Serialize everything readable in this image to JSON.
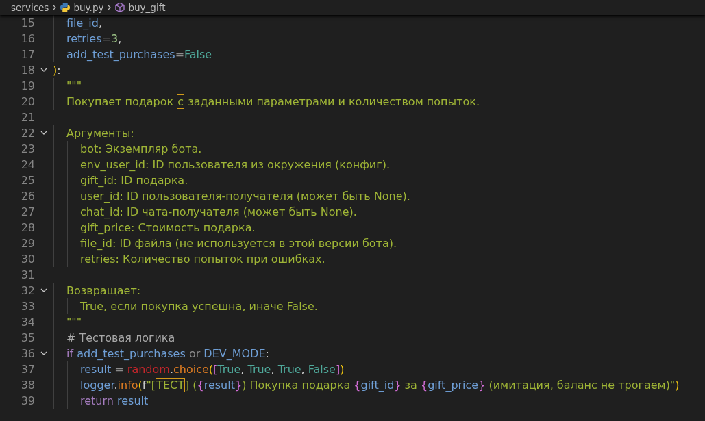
{
  "breadcrumb": [
    {
      "label": "services",
      "kind": "folder"
    },
    {
      "label": "buy.py",
      "kind": "python"
    },
    {
      "label": "buy_gift",
      "kind": "function"
    }
  ],
  "lines": [
    {
      "number": "15",
      "fold": false,
      "tokens": [
        {
          "text": "    file_id",
          "kind": "var"
        },
        {
          "text": ",",
          "kind": "punct"
        }
      ]
    },
    {
      "number": "16",
      "fold": false,
      "tokens": [
        {
          "text": "    retries",
          "kind": "var"
        },
        {
          "text": "=",
          "kind": "op"
        },
        {
          "text": "3",
          "kind": "num"
        },
        {
          "text": ",",
          "kind": "punct"
        }
      ]
    },
    {
      "number": "17",
      "fold": false,
      "tokens": [
        {
          "text": "    add_test_purchases",
          "kind": "var"
        },
        {
          "text": "=",
          "kind": "op"
        },
        {
          "text": "False",
          "kind": "const"
        }
      ]
    },
    {
      "number": "18",
      "fold": true,
      "tokens": [
        {
          "text": ")",
          "kind": "paren"
        },
        {
          "text": ":",
          "kind": "punct"
        }
      ]
    },
    {
      "number": "19",
      "fold": false,
      "tokens": [
        {
          "text": "    \"\"\"",
          "kind": "doc"
        }
      ]
    },
    {
      "number": "20",
      "fold": false,
      "tokens": [
        {
          "text": "    Покупает подарок ",
          "kind": "doc"
        },
        {
          "text": "с",
          "kind": "doc",
          "boxed": true
        },
        {
          "text": " заданными параметрами и количеством попыток.",
          "kind": "doc"
        }
      ]
    },
    {
      "number": "21",
      "fold": false
    },
    {
      "number": "22",
      "fold": true,
      "tokens": [
        {
          "text": "    Аргументы:",
          "kind": "doc"
        }
      ]
    },
    {
      "number": "23",
      "fold": false,
      "tokens": [
        {
          "text": "        bot: Экземпляр бота.",
          "kind": "doc"
        }
      ]
    },
    {
      "number": "24",
      "fold": false,
      "tokens": [
        {
          "text": "        env_user_id: ID пользователя из окружения (конфиг).",
          "kind": "doc"
        }
      ]
    },
    {
      "number": "25",
      "fold": false,
      "tokens": [
        {
          "text": "        gift_id: ID подарка.",
          "kind": "doc"
        }
      ]
    },
    {
      "number": "26",
      "fold": false,
      "tokens": [
        {
          "text": "        user_id: ID пользователя-получателя (может быть None).",
          "kind": "doc"
        }
      ]
    },
    {
      "number": "27",
      "fold": false,
      "tokens": [
        {
          "text": "        chat_id: ID чата-получателя (может быть None).",
          "kind": "doc"
        }
      ]
    },
    {
      "number": "28",
      "fold": false,
      "tokens": [
        {
          "text": "        gift_price: Стоимость подарка.",
          "kind": "doc"
        }
      ]
    },
    {
      "number": "29",
      "fold": false,
      "tokens": [
        {
          "text": "        file_id: ID файла (не используется в этой версии бота).",
          "kind": "doc"
        }
      ]
    },
    {
      "number": "30",
      "fold": false,
      "tokens": [
        {
          "text": "        retries: Количество попыток при ошибках.",
          "kind": "doc"
        }
      ]
    },
    {
      "number": "31",
      "fold": false
    },
    {
      "number": "32",
      "fold": true,
      "tokens": [
        {
          "text": "    Возвращает:",
          "kind": "doc"
        }
      ]
    },
    {
      "number": "33",
      "fold": false,
      "tokens": [
        {
          "text": "        True, если покупка успешна, иначе False.",
          "kind": "doc"
        }
      ]
    },
    {
      "number": "34",
      "fold": false,
      "tokens": [
        {
          "text": "    \"\"\"",
          "kind": "doc"
        }
      ]
    },
    {
      "number": "35",
      "fold": false,
      "tokens": [
        {
          "text": "    # Тестовая логика",
          "kind": "comment"
        }
      ]
    },
    {
      "number": "36",
      "fold": true,
      "tokens": [
        {
          "text": "    if ",
          "kind": "kw"
        },
        {
          "text": "add_test_purchases",
          "kind": "var"
        },
        {
          "text": " or ",
          "kind": "op"
        },
        {
          "text": "DEV_MODE",
          "kind": "var"
        },
        {
          "text": ":",
          "kind": "punct"
        }
      ]
    },
    {
      "number": "37",
      "fold": false,
      "tokens": [
        {
          "text": "        result",
          "kind": "var"
        },
        {
          "text": " = ",
          "kind": "op"
        },
        {
          "text": "random",
          "kind": "module"
        },
        {
          "text": ".",
          "kind": "punct"
        },
        {
          "text": "choice",
          "kind": "method"
        },
        {
          "text": "(",
          "kind": "paren"
        },
        {
          "text": "[",
          "kind": "brace"
        },
        {
          "text": "True",
          "kind": "const"
        },
        {
          "text": ", ",
          "kind": "punct"
        },
        {
          "text": "True",
          "kind": "const"
        },
        {
          "text": ", ",
          "kind": "punct"
        },
        {
          "text": "True",
          "kind": "const"
        },
        {
          "text": ", ",
          "kind": "punct"
        },
        {
          "text": "False",
          "kind": "const"
        },
        {
          "text": "]",
          "kind": "brace"
        },
        {
          "text": ")",
          "kind": "paren"
        }
      ]
    },
    {
      "number": "38",
      "fold": false,
      "tokens": [
        {
          "text": "        logger",
          "kind": "var"
        },
        {
          "text": ".",
          "kind": "punct"
        },
        {
          "text": "info",
          "kind": "method"
        },
        {
          "text": "(",
          "kind": "paren"
        },
        {
          "text": "f",
          "kind": "punct"
        },
        {
          "text": "\"[",
          "kind": "str"
        },
        {
          "text": "ТЕСТ",
          "kind": "str",
          "boxed": true
        },
        {
          "text": "] (",
          "kind": "str"
        },
        {
          "text": "{",
          "kind": "brace"
        },
        {
          "text": "result",
          "kind": "var"
        },
        {
          "text": "}",
          "kind": "brace"
        },
        {
          "text": ") Покупка подарка ",
          "kind": "str"
        },
        {
          "text": "{",
          "kind": "brace"
        },
        {
          "text": "gift_id",
          "kind": "var"
        },
        {
          "text": "}",
          "kind": "brace"
        },
        {
          "text": " за ",
          "kind": "str"
        },
        {
          "text": "{",
          "kind": "brace"
        },
        {
          "text": "gift_price",
          "kind": "var"
        },
        {
          "text": "}",
          "kind": "brace"
        },
        {
          "text": " (имитация, баланс не трогаем)\"",
          "kind": "str"
        },
        {
          "text": ")",
          "kind": "paren"
        }
      ]
    },
    {
      "number": "39",
      "fold": false,
      "tokens": [
        {
          "text": "        return ",
          "kind": "kw"
        },
        {
          "text": "result",
          "kind": "var"
        }
      ]
    }
  ]
}
